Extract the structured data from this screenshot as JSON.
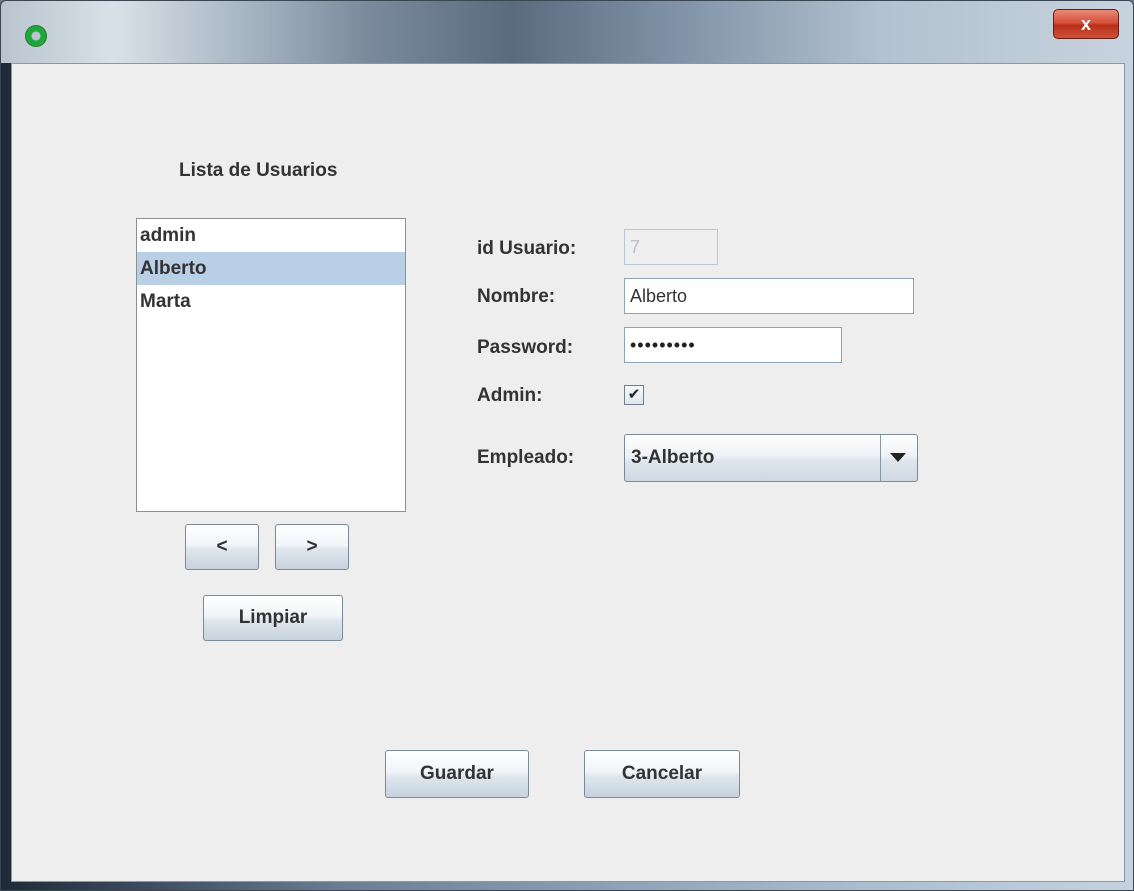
{
  "window": {
    "close_label": "x"
  },
  "user_list": {
    "title": "Lista de Usuarios",
    "items": [
      "admin",
      "Alberto",
      "Marta"
    ],
    "selected": "Alberto"
  },
  "nav": {
    "prev_label": "<",
    "next_label": ">",
    "clear_label": "Limpiar"
  },
  "form": {
    "id_label": "id Usuario:",
    "id_value": "7",
    "name_label": "Nombre:",
    "name_value": "Alberto",
    "password_label": "Password:",
    "password_value": "•••••••••",
    "admin_label": "Admin:",
    "admin_checked": true,
    "admin_check_glyph": "✔",
    "employee_label": "Empleado:",
    "employee_value": "3-Alberto"
  },
  "actions": {
    "save_label": "Guardar",
    "cancel_label": "Cancelar"
  },
  "colors": {
    "selection": "#b8cfe5",
    "panel_bg": "#eeeeee",
    "close_red": "#d6513a"
  },
  "icons": {
    "app": "java-gear-icon",
    "close": "close-icon",
    "dropdown": "chevron-down-icon"
  }
}
